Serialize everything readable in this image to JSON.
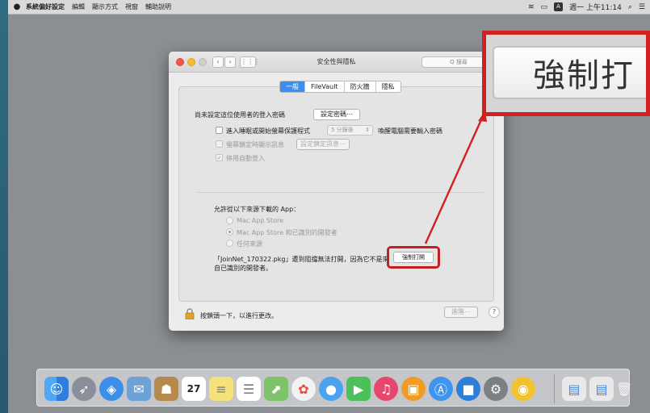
{
  "menubar": {
    "apple": "",
    "items": [
      "系統偏好設定",
      "編輯",
      "顯示方式",
      "視窗",
      "輔助說明"
    ],
    "clock": "週一 上午11:14",
    "badge": "A"
  },
  "window": {
    "title": "安全性與隱私",
    "search_placeholder": "Q 搜尋",
    "tabs": [
      "一般",
      "FileVault",
      "防火牆",
      "隱私"
    ],
    "login_password_text": "尚未設定這位使用者的登入密碼",
    "set_password_button": "設定密碼⋯",
    "require_password_text": "進入睡眠或開始螢幕保護程式",
    "require_password_select": "5 分鐘後",
    "require_password_suffix": "喚醒電腦需要輸入密碼",
    "show_message_text": "螢幕鎖定時顯示訊息",
    "set_lock_message_button": "設定鎖定訊息⋯",
    "disable_autologin_text": "停用自動登入",
    "allow_apps_heading": "允許從以下來源下載的 App：",
    "radio_options": [
      "Mac App Store",
      "Mac App Store 和已識別的開發者",
      "任何來源"
    ],
    "blocked_line1": "「JoinNet_170322.pkg」遭到阻擋無法打開，因為它不是來",
    "blocked_line2": "自已識別的開發者。",
    "open_anyway_button": "強制打開",
    "lock_text": "按鎖頭一下，以進行更改。",
    "advanced_button": "進階⋯",
    "help_button": "?"
  },
  "callout": {
    "text": "強制打"
  },
  "dock": {
    "apps": [
      "finder-icon",
      "launchpad-icon",
      "safari-icon",
      "mail-icon",
      "contacts-icon",
      "calendar-icon",
      "notes-icon",
      "reminders-icon",
      "maps-icon",
      "photos-icon",
      "messages-icon",
      "facetime-icon",
      "itunes-icon",
      "ibooks-icon",
      "appstore-icon",
      "facetime-video-icon",
      "system-preferences-icon",
      "chrome-icon",
      "downloads-icon",
      "documents-icon",
      "trash-icon"
    ],
    "calendar_day": "27"
  },
  "colors": {
    "accent": "#3d8ef2",
    "highlight": "#d21f1f"
  }
}
